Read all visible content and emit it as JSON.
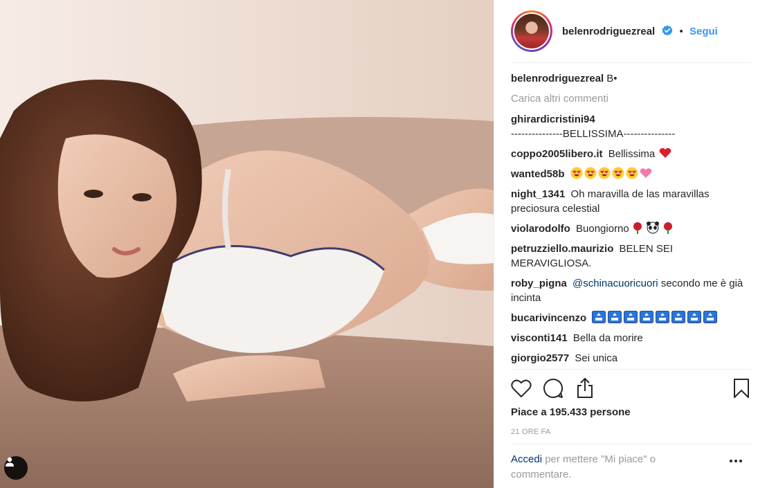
{
  "post": {
    "author": {
      "username": "belenrodriguezreal",
      "verified": true,
      "follow_label": "Segui",
      "separator": "•"
    },
    "caption": {
      "username": "belenrodriguezreal",
      "text": "B•"
    },
    "load_more_label": "Carica altri commenti",
    "comments": [
      {
        "user": "ghirardicristini94",
        "text": "---------------BELLISSIMA---------------"
      },
      {
        "user": "coppo2005libero.it",
        "text": "Bellissima",
        "emoji": "red-heart"
      },
      {
        "user": "wanted58b",
        "text": "",
        "emoji": "heart-eyes x5, pink-heart"
      },
      {
        "user": "night_1341",
        "text": "Oh maravilla de las maravillas preciosura celestial"
      },
      {
        "user": "violarodolfo",
        "text": "Buongiorno",
        "emoji": "rose, panda, rose"
      },
      {
        "user": "petruzziello.maurizio",
        "text": "BELEN SEI MERAVIGLIOSA."
      },
      {
        "user": "roby_pigna",
        "mention": "@schinacuoricuori",
        "text": "secondo me è già incinta"
      },
      {
        "user": "bucarivincenzo",
        "text": "",
        "emoji": "top x8"
      },
      {
        "user": "visconti141",
        "text": "Bella da morire"
      },
      {
        "user": "giorgio2577",
        "text": "Sei unica"
      }
    ],
    "likes_text": "Piace a 195.433 persone",
    "timestamp": "21 ORE FA",
    "login_prompt": {
      "link": "Accedi",
      "text": "per mettere \"Mi piace\" o commentare."
    },
    "icons": {
      "like": "heart-icon",
      "comment": "comment-icon",
      "share": "share-icon",
      "save": "bookmark-icon",
      "user_tag": "user-tag-icon",
      "options": "more-options-icon"
    },
    "colors": {
      "follow": "#3897f0",
      "link": "#003569",
      "muted": "#999999",
      "text": "#262626",
      "verified": "#3897f0"
    }
  }
}
